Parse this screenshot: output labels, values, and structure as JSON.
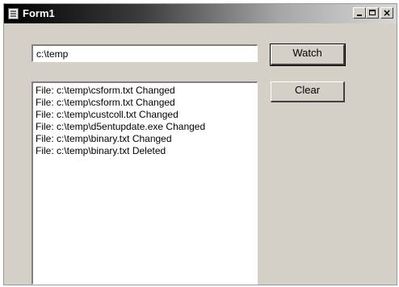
{
  "window": {
    "title": "Form1",
    "controls": {
      "minimize_icon": "minimize-icon",
      "maximize_icon": "maximize-icon",
      "close_label": "×"
    }
  },
  "watch": {
    "path_value": "c:\\temp",
    "watch_label": "Watch",
    "clear_label": "Clear"
  },
  "log": {
    "items": [
      "File: c:\\temp\\csform.txt Changed",
      "File: c:\\temp\\csform.txt Changed",
      "File: c:\\temp\\custcoll.txt Changed",
      "File: c:\\temp\\d5entupdate.exe Changed",
      "File: c:\\temp\\binary.txt Changed",
      "File: c:\\temp\\binary.txt Deleted"
    ]
  }
}
